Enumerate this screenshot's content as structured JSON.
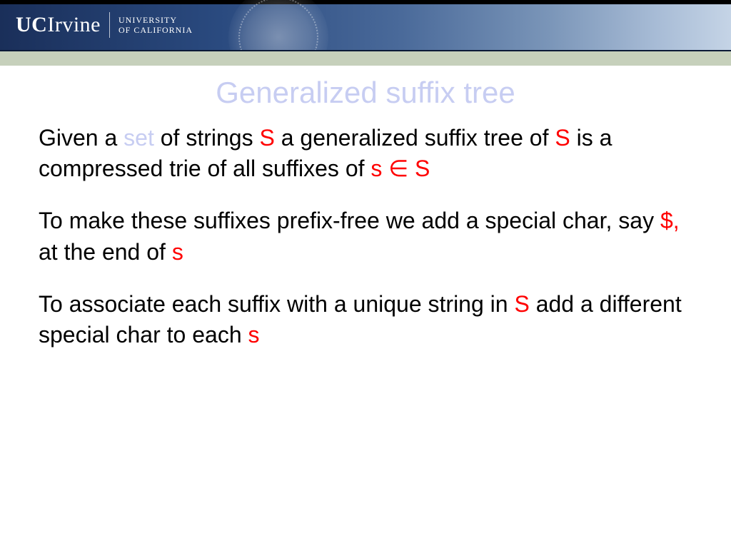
{
  "header": {
    "logo_uc": "UC",
    "logo_irvine": "Irvine",
    "univ_line1": "UNIVERSITY",
    "univ_line2_of": "OF ",
    "univ_line2_cal": "CALIFORNIA"
  },
  "slide": {
    "title": "Generalized suffix tree",
    "p1": {
      "t1": "Given a ",
      "set": "set",
      "t2": " of strings ",
      "S1": "S",
      "t3": " a generalized suffix tree of ",
      "S2": "S",
      "t4": " is a compressed trie of all suffixes of ",
      "s_in_S": "s ∈ S"
    },
    "p2": {
      "t1": "To make these suffixes prefix-free we add a special char, say ",
      "dollar": "$,",
      "t2": " at the end of ",
      "s": "s"
    },
    "p3": {
      "t1": "To associate each suffix with a unique string in ",
      "S": "S",
      "t2": " add a different special char to each ",
      "s": "s"
    }
  }
}
